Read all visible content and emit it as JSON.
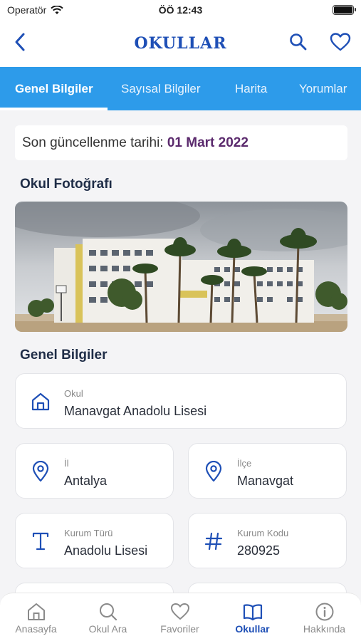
{
  "status_bar": {
    "carrier": "Operatör",
    "time": "ÖÖ 12:43"
  },
  "navbar": {
    "title": "OKULLAR"
  },
  "tabs": [
    {
      "label": "Genel Bilgiler"
    },
    {
      "label": "Sayısal Bilgiler"
    },
    {
      "label": "Harita"
    },
    {
      "label": "Yorumlar"
    }
  ],
  "update": {
    "prefix": "Son güncellenme tarihi:",
    "date": "01 Mart 2022"
  },
  "photo_section": {
    "title": "Okul Fotoğrafı"
  },
  "info_section": {
    "title": "Genel Bilgiler",
    "okul": {
      "label": "Okul",
      "value": "Manavgat Anadolu Lisesi"
    },
    "il": {
      "label": "İl",
      "value": "Antalya"
    },
    "ilce": {
      "label": "İlçe",
      "value": "Manavgat"
    },
    "kurum_turu": {
      "label": "Kurum Türü",
      "value": "Anadolu Lisesi"
    },
    "kurum_kodu": {
      "label": "Kurum Kodu",
      "value": "280925"
    }
  },
  "bottom_nav": [
    {
      "label": "Anasayfa",
      "icon": "home-icon"
    },
    {
      "label": "Okul Ara",
      "icon": "search-icon"
    },
    {
      "label": "Favoriler",
      "icon": "heart-icon"
    },
    {
      "label": "Okullar",
      "icon": "book-icon",
      "active": true
    },
    {
      "label": "Hakkında",
      "icon": "info-icon"
    }
  ],
  "colors": {
    "accent": "#1e4fb6",
    "tab_bar": "#2d9bea",
    "date": "#5b2a6d"
  }
}
